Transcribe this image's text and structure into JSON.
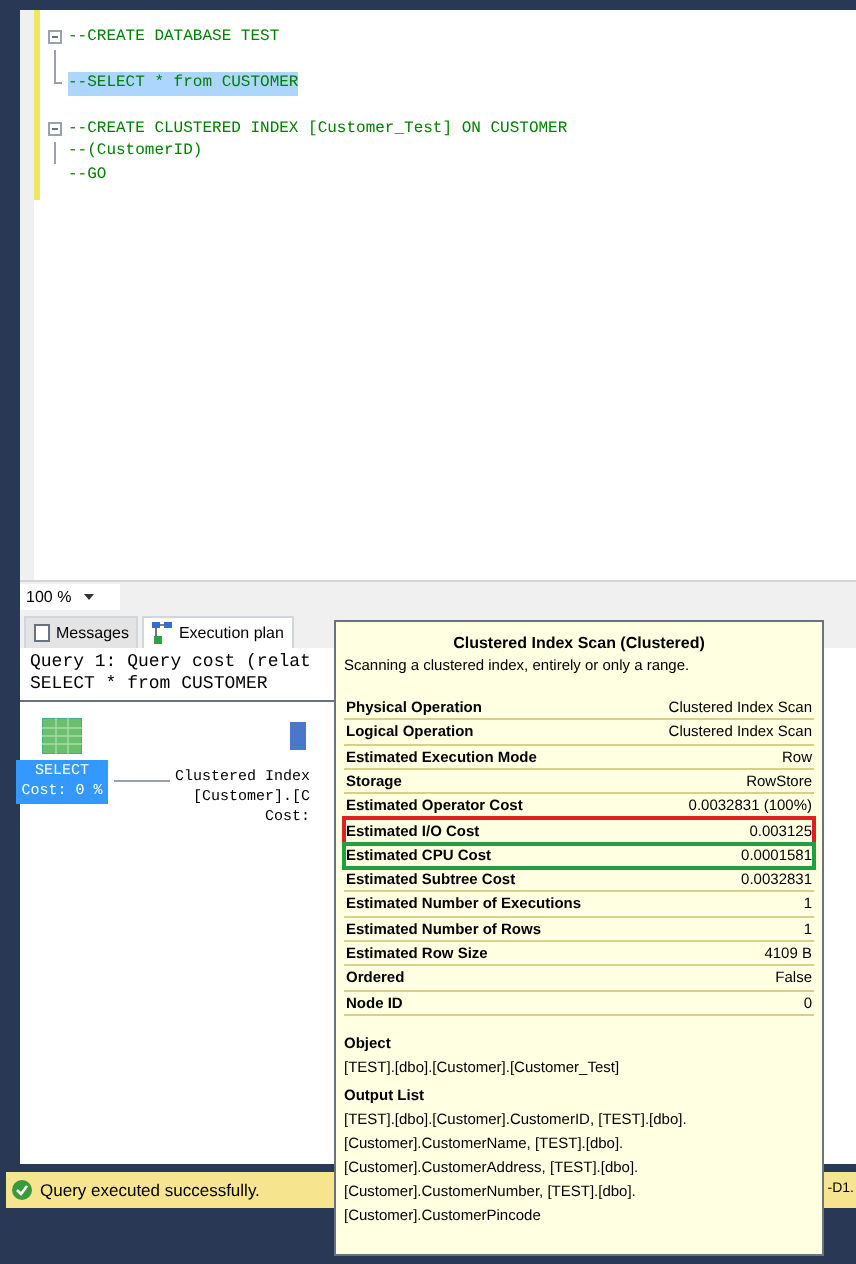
{
  "editor": {
    "lines": [
      {
        "kind": "foldstart",
        "text": "--CREATE DATABASE TEST",
        "selected": false
      },
      {
        "kind": "foldinner"
      },
      {
        "kind": "foldend",
        "text": "--SELECT * from CUSTOMER",
        "selected": true
      },
      {
        "kind": "blank"
      },
      {
        "kind": "foldstart",
        "text": "--CREATE CLUSTERED INDEX [Customer_Test] ON CUSTOMER",
        "selected": false
      },
      {
        "kind": "foldinner",
        "text": "--(CustomerID)",
        "selected": false
      },
      {
        "kind": "plain",
        "text": "--GO",
        "selected": false
      }
    ]
  },
  "zoom": {
    "value": "100 %"
  },
  "result_tabs": [
    {
      "label": "Messages",
      "selected": false
    },
    {
      "label": "Execution plan",
      "selected": true
    }
  ],
  "plan": {
    "query_lines": [
      "Query 1: Query cost (relat",
      "SELECT * from CUSTOMER"
    ],
    "select_node": {
      "label": "SELECT",
      "cost": "Cost: 0 %",
      "selected": true
    },
    "scan_node": {
      "lines": [
        "Clustered Index",
        "[Customer].[C",
        "Cost:"
      ]
    }
  },
  "tooltip": {
    "title": "Clustered Index Scan (Clustered)",
    "description": "Scanning a clustered index, entirely or only a range.",
    "rows": [
      {
        "label": "Physical Operation",
        "value": "Clustered Index Scan"
      },
      {
        "label": "Logical Operation",
        "value": "Clustered Index Scan"
      },
      {
        "label": "Estimated Execution Mode",
        "value": "Row"
      },
      {
        "label": "Storage",
        "value": "RowStore"
      },
      {
        "label": "Estimated Operator Cost",
        "value": "0.0032831 (100%)"
      },
      {
        "label": "Estimated I/O Cost",
        "value": "0.003125",
        "color": "#e02020"
      },
      {
        "label": "Estimated CPU Cost",
        "value": "0.0001581",
        "color": "#20a040"
      },
      {
        "label": "Estimated Subtree Cost",
        "value": "0.0032831"
      },
      {
        "label": "Estimated Number of Executions",
        "value": "1"
      },
      {
        "label": "Estimated Number of Rows",
        "value": "1"
      },
      {
        "label": "Estimated Row Size",
        "value": "4109 B"
      },
      {
        "label": "Ordered",
        "value": "False"
      },
      {
        "label": "Node ID",
        "value": "0"
      }
    ],
    "sections": [
      {
        "heading": "Object",
        "text": "[TEST].[dbo].[Customer].[Customer_Test]"
      },
      {
        "heading": "Output List",
        "text": "[TEST].[dbo].[Customer].CustomerID, [TEST].[dbo].[Customer].CustomerName, [TEST].[dbo].[Customer].CustomerAddress, [TEST].[dbo].[Customer].CustomerNumber, [TEST].[dbo].[Customer].CustomerPincode"
      }
    ]
  },
  "status_bar": {
    "message": "Query executed successfully.",
    "right": "-D1."
  }
}
